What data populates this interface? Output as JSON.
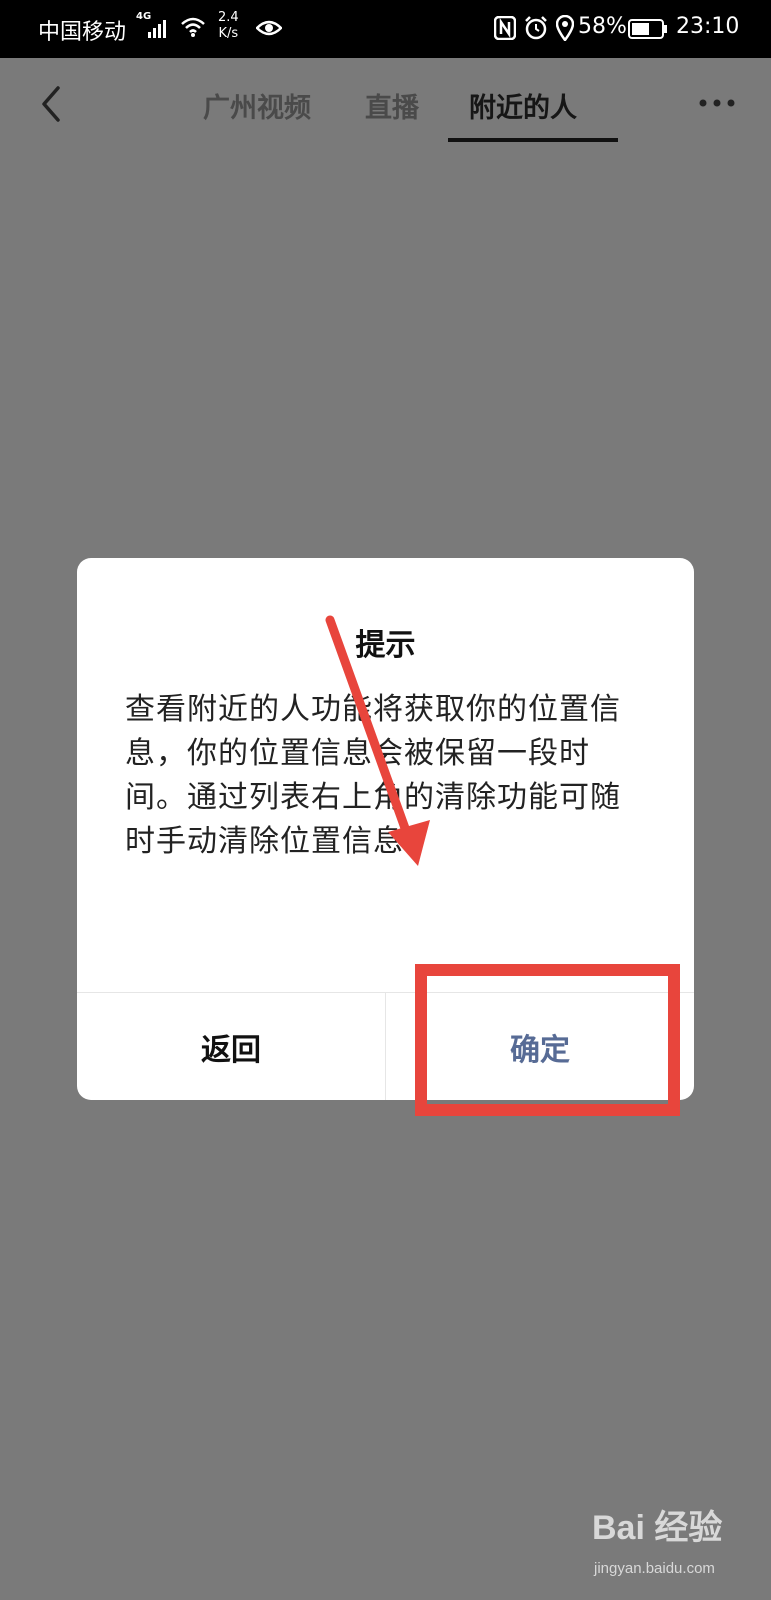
{
  "status_bar": {
    "carrier": "中国移动",
    "network_tag": "4G",
    "speed_value": "2.4",
    "speed_unit": "K/s",
    "battery_pct": "58%",
    "time": "23:10",
    "icons": [
      "signal-icon",
      "wifi-icon",
      "eye-icon",
      "nfc-icon",
      "alarm-icon",
      "location-icon",
      "battery-icon"
    ]
  },
  "navbar": {
    "back_icon": "chevron-left-icon",
    "tabs": [
      {
        "label": "广州视频",
        "active": false
      },
      {
        "label": "直播",
        "active": false
      },
      {
        "label": "附近的人",
        "active": true
      }
    ],
    "more_icon": "more-horizontal-icon"
  },
  "dialog": {
    "title": "提示",
    "body": "查看附近的人功能将获取你的位置信息，你的位置信息会被保留一段时间。通过列表右上角的清除功能可随时手动清除位置信息。",
    "cancel_label": "返回",
    "confirm_label": "确定"
  },
  "annotations": {
    "arrow_color": "#e8453c",
    "box_color": "#e8453c"
  },
  "watermark": {
    "logo": "Bai 经验",
    "url": "jingyan.baidu.com"
  },
  "colors": {
    "overlay": "#7a7a7a",
    "confirm_text": "#576b95"
  }
}
